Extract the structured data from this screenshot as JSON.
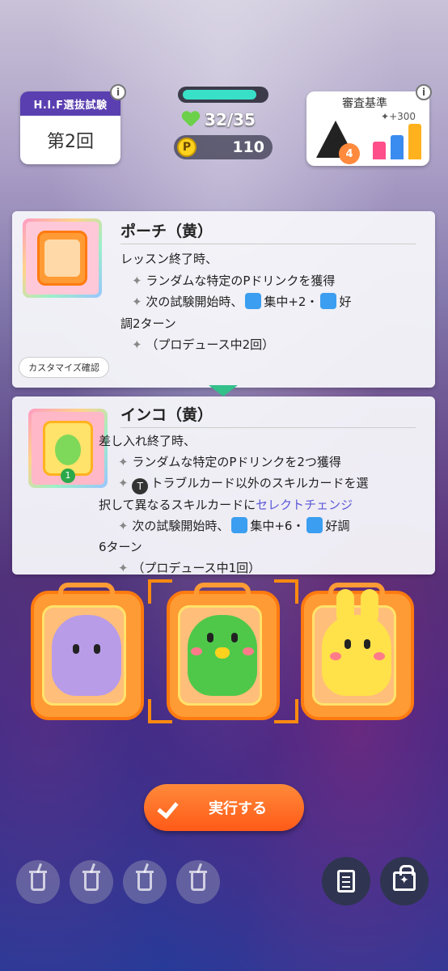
{
  "hud": {
    "exam_title": "H.I.F選抜試験",
    "exam_round": "第2回",
    "stamina_text": "32/35",
    "stamina_fraction": 0.914,
    "p_coin_label": "P",
    "p_points": "110",
    "criteria_title": "審査基準",
    "criteria_bonus": "+300",
    "criteria_rank": "4",
    "info_icon": "i"
  },
  "card1": {
    "name": "ポーチ（黄）",
    "trigger": "レッスン終了時、",
    "line1": "ランダムな特定のPドリンクを獲得",
    "line2a": "次の試験開始時、",
    "line2b": "集中+2・",
    "line2c": "好",
    "line3": "調2ターン",
    "line4": "（プロデュース中2回）",
    "customize_label": "カスタマイズ確認"
  },
  "card2": {
    "name": "インコ（黄）",
    "trigger": "差し入れ終了時、",
    "line1": "ランダムな特定のPドリンクを2つ獲得",
    "t_icon": "T",
    "line2a": "トラブルカード",
    "line2b": "以外のスキルカードを選",
    "line3a": "択して異なるスキルカードに",
    "line3b": "セレクトチェンジ",
    "line4a": "次の試験開始時、",
    "line4b": "集中+6・",
    "line4c": "好調",
    "line5": "6ターン",
    "line6": "（プロデュース中1回）",
    "badge": "1"
  },
  "actions": {
    "execute_label": "実行する"
  },
  "colors": {
    "accent": "#ff6a20",
    "highlight": "#5a58d6",
    "stamina": "#39e0c8"
  }
}
